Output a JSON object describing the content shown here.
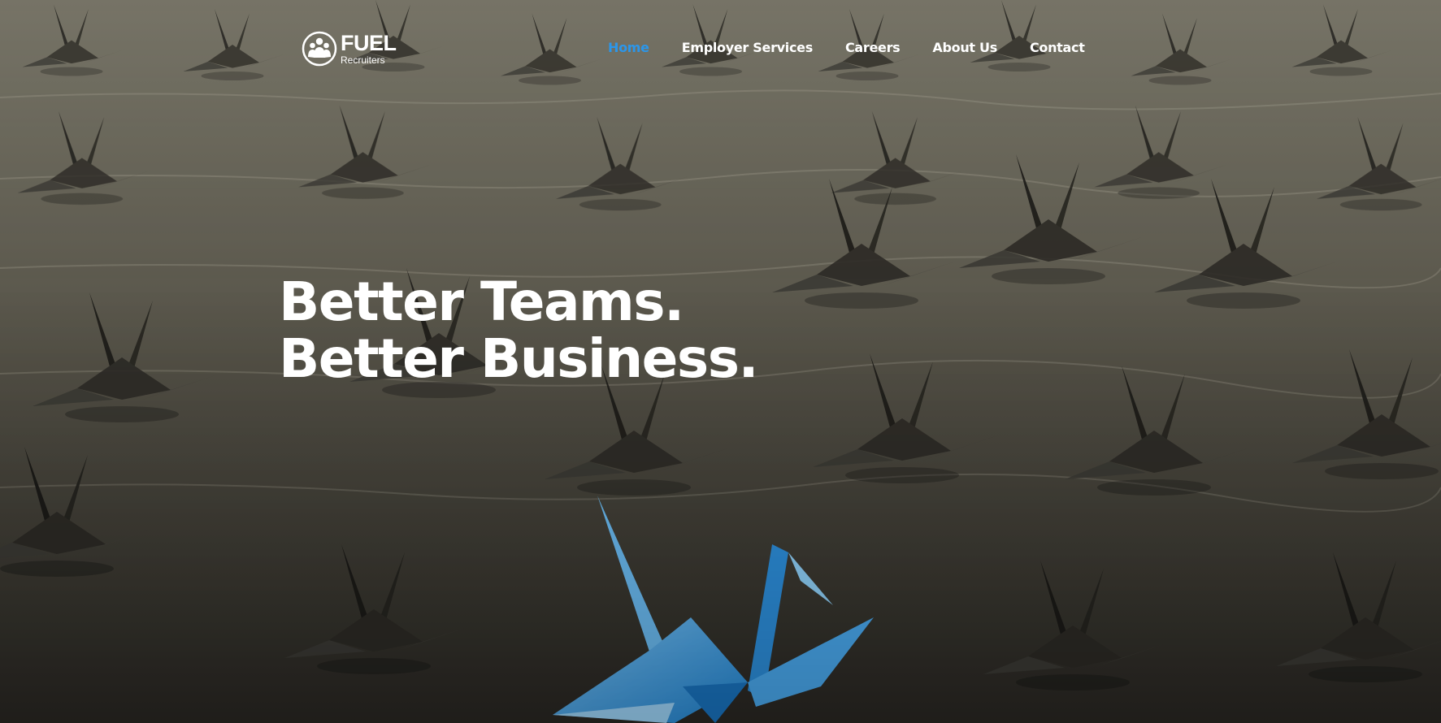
{
  "brand": {
    "name": "FUEL",
    "tagline": "Recruiters"
  },
  "nav": {
    "items": [
      {
        "label": "Home",
        "active": true
      },
      {
        "label": "Employer Services",
        "active": false
      },
      {
        "label": "Careers",
        "active": false
      },
      {
        "label": "About Us",
        "active": false
      },
      {
        "label": "Contact",
        "active": false
      }
    ]
  },
  "hero": {
    "line1": "Better Teams.",
    "line2": "Better Business."
  },
  "colors": {
    "accent": "#2b96ea",
    "text": "#ffffff",
    "crane_highlight": "#3aa0ea"
  }
}
